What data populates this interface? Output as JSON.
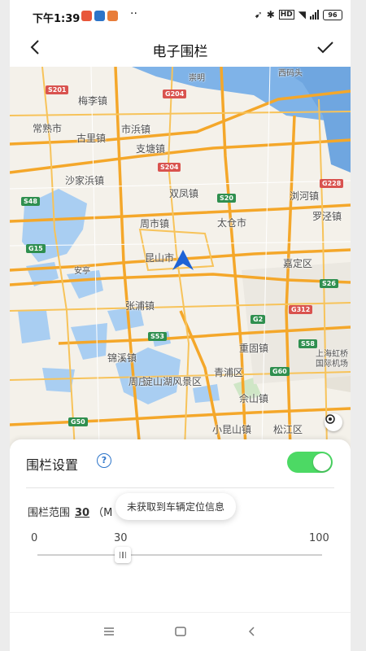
{
  "status_bar": {
    "time": "下午1:39",
    "battery": "96",
    "icons": [
      "notification-icon-a",
      "notification-icon-b",
      "notification-icon-c",
      "more-dots",
      "location-icon",
      "bluetooth-icon",
      "hd-icon",
      "wifi-icon",
      "signal-icon",
      "battery-icon"
    ],
    "more": "··"
  },
  "header": {
    "title": "电子围栏",
    "back_icon": "chevron-left-icon",
    "confirm_icon": "check-icon"
  },
  "map": {
    "places": [
      {
        "name": "梅李镇"
      },
      {
        "name": "常熟市"
      },
      {
        "name": "古里镇"
      },
      {
        "name": "沙家浜镇"
      },
      {
        "name": "市浜镇"
      },
      {
        "name": "支塘镇"
      },
      {
        "name": "双凤镇"
      },
      {
        "name": "浏河镇"
      },
      {
        "name": "罗泾镇"
      },
      {
        "name": "周市镇"
      },
      {
        "name": "太仓市"
      },
      {
        "name": "昆山市"
      },
      {
        "name": "嘉定区"
      },
      {
        "name": "张浦镇"
      },
      {
        "name": "安亭"
      },
      {
        "name": "锦溪镇"
      },
      {
        "name": "周庄"
      },
      {
        "name": "重固镇"
      },
      {
        "name": "青浦区"
      },
      {
        "name": "淀山湖风景区"
      },
      {
        "name": "佘山镇"
      },
      {
        "name": "小昆山镇"
      },
      {
        "name": "松江区"
      },
      {
        "name": "上海虹桥国际机场"
      },
      {
        "name": "崇明"
      },
      {
        "name": "西码头"
      }
    ],
    "shields": [
      {
        "code": "S201",
        "kind": "red"
      },
      {
        "code": "G204",
        "kind": "red"
      },
      {
        "code": "S204",
        "kind": "red"
      },
      {
        "code": "S20",
        "kind": "grn"
      },
      {
        "code": "S48",
        "kind": "grn"
      },
      {
        "code": "S26",
        "kind": "grn"
      },
      {
        "code": "G2",
        "kind": "grn"
      },
      {
        "code": "G312",
        "kind": "red"
      },
      {
        "code": "S58",
        "kind": "grn"
      },
      {
        "code": "G60",
        "kind": "grn"
      },
      {
        "code": "G15",
        "kind": "grn"
      },
      {
        "code": "S53",
        "kind": "grn"
      },
      {
        "code": "G50",
        "kind": "grn"
      },
      {
        "code": "G228",
        "kind": "red"
      }
    ],
    "locate_icon": "locate-target-icon"
  },
  "fence": {
    "title": "围栏设置",
    "help": "?",
    "enabled": true,
    "range_label": "围栏范围",
    "range_value": "30",
    "range_unit": "（M",
    "toast": "未获取到车辆定位信息",
    "min_label": "0",
    "current_label": "30",
    "max_label": "100",
    "slider_value": 30,
    "slider_min": 0,
    "slider_max": 100
  },
  "nav": {
    "menu_icon": "menu-icon",
    "home_icon": "home-square-icon",
    "back_icon": "back-triangle-icon"
  }
}
